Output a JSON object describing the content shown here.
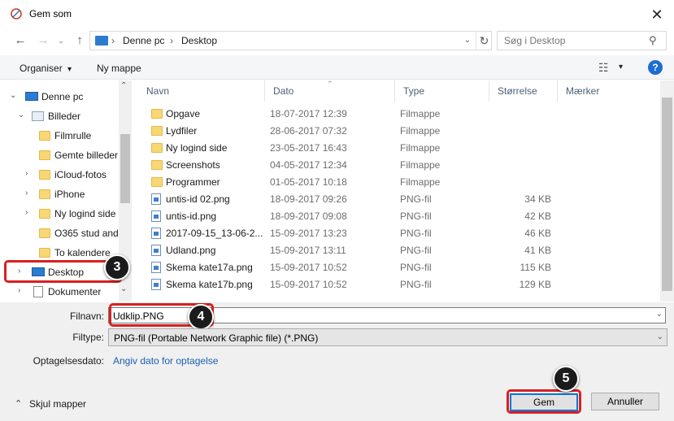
{
  "window": {
    "title": "Gem som",
    "close_glyph": "✕"
  },
  "nav_buttons": {
    "back": "←",
    "forward": "→",
    "up": "↑"
  },
  "address": {
    "segments": [
      "Denne pc",
      "Desktop"
    ],
    "separator": "›",
    "dropdown": "⌄",
    "refresh": "↻"
  },
  "search": {
    "placeholder": "Søg i Desktop",
    "icon": "⚲"
  },
  "toolbar": {
    "organize": "Organiser",
    "organize_chevron": "▾",
    "new_folder": "Ny mappe",
    "view_glyph": "☷",
    "view_chevron": "▾",
    "help": "?"
  },
  "navpane": {
    "items": [
      {
        "label": "Denne pc",
        "chev": "⌄",
        "icon": "pc-icon"
      },
      {
        "label": "Billeder",
        "chev": "⌄",
        "icon": "pictures-icon"
      },
      {
        "label": "Filmrulle",
        "chev": "",
        "icon": "folder-icon"
      },
      {
        "label": "Gemte billeder",
        "chev": "",
        "icon": "folder-icon"
      },
      {
        "label": "iCloud-fotos",
        "chev": "›",
        "icon": "folder-icon"
      },
      {
        "label": "iPhone",
        "chev": "›",
        "icon": "folder-icon"
      },
      {
        "label": "Ny logind side",
        "chev": "›",
        "icon": "folder-icon"
      },
      {
        "label": "O365 stud andı",
        "chev": "",
        "icon": "folder-icon"
      },
      {
        "label": "To kalendere",
        "chev": "",
        "icon": "folder-icon"
      },
      {
        "label": "Desktop",
        "chev": "›",
        "icon": "desktop-icon"
      },
      {
        "label": "Dokumenter",
        "chev": "›",
        "icon": "documents-icon"
      }
    ],
    "scroll_up": "⌃",
    "scroll_down": "⌄"
  },
  "columns": {
    "name": "Navn",
    "date": "Dato",
    "type": "Type",
    "size": "Størrelse",
    "tags": "Mærker"
  },
  "sort_glyph": "⌃",
  "files": [
    {
      "name": "Opgave",
      "date": "18-07-2017 12:39",
      "type": "Filmappe",
      "size": "",
      "kind": "folder"
    },
    {
      "name": "Lydfiler",
      "date": "28-06-2017 07:32",
      "type": "Filmappe",
      "size": "",
      "kind": "folder"
    },
    {
      "name": "Ny logind side",
      "date": "23-05-2017 16:43",
      "type": "Filmappe",
      "size": "",
      "kind": "folder"
    },
    {
      "name": "Screenshots",
      "date": "04-05-2017 12:34",
      "type": "Filmappe",
      "size": "",
      "kind": "folder"
    },
    {
      "name": "Programmer",
      "date": "01-05-2017 10:18",
      "type": "Filmappe",
      "size": "",
      "kind": "folder"
    },
    {
      "name": "untis-id 02.png",
      "date": "18-09-2017 09:26",
      "type": "PNG-fil",
      "size": "34 KB",
      "kind": "png"
    },
    {
      "name": "untis-id.png",
      "date": "18-09-2017 09:08",
      "type": "PNG-fil",
      "size": "42 KB",
      "kind": "png"
    },
    {
      "name": "2017-09-15_13-06-2...",
      "date": "15-09-2017 13:23",
      "type": "PNG-fil",
      "size": "46 KB",
      "kind": "png"
    },
    {
      "name": "Udland.png",
      "date": "15-09-2017 13:11",
      "type": "PNG-fil",
      "size": "41 KB",
      "kind": "png"
    },
    {
      "name": "Skema kate17a.png",
      "date": "15-09-2017 10:52",
      "type": "PNG-fil",
      "size": "115 KB",
      "kind": "png"
    },
    {
      "name": "Skema kate17b.png",
      "date": "15-09-2017 10:52",
      "type": "PNG-fil",
      "size": "129 KB",
      "kind": "png"
    }
  ],
  "form": {
    "filename_label": "Filnavn:",
    "filename_value": "Udklip.PNG",
    "filetype_label": "Filtype:",
    "filetype_value": "PNG-fil (Portable Network Graphic file) (*.PNG)",
    "date_label": "Optagelsesdato:",
    "date_link": "Angiv dato for optagelse",
    "dropdown": "⌄"
  },
  "footer": {
    "hide_folders": "Skjul mapper",
    "hide_chevron": "⌃",
    "save": "Gem",
    "cancel": "Annuller"
  },
  "callouts": [
    "3",
    "4",
    "5"
  ],
  "colors": {
    "highlight": "#d92020",
    "accent": "#0078d7",
    "selection": "#cce8ff"
  }
}
